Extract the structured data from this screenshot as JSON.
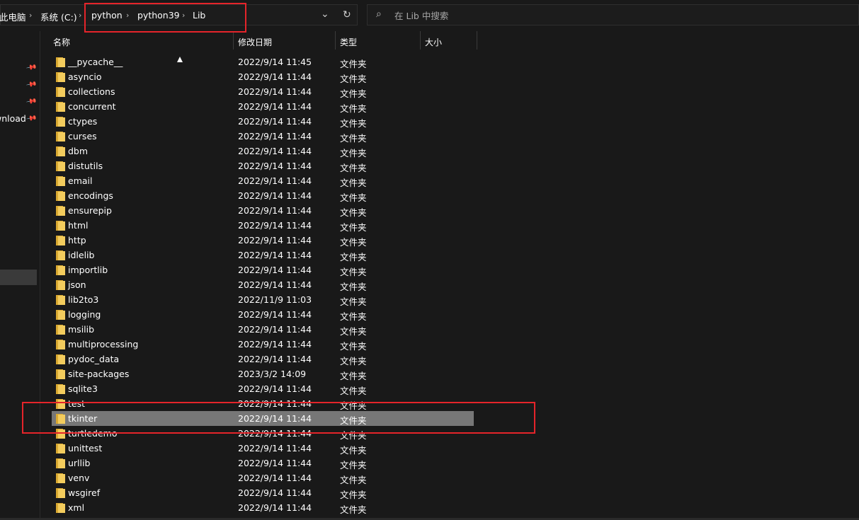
{
  "breadcrumb": {
    "items": [
      "此电脑",
      "系统 (C:)",
      "python",
      "python39",
      "Lib"
    ],
    "separator_icon": "chevron-right-icon"
  },
  "address_tools": {
    "dropdown_icon": "chevron-down-icon",
    "refresh_icon": "refresh-icon"
  },
  "search": {
    "placeholder": "在 Lib 中搜索",
    "value": "",
    "icon": "search-icon"
  },
  "navigation": {
    "partial_label": "wnload",
    "pin_icon": "pin-icon"
  },
  "columns": {
    "name": "名称",
    "date": "修改日期",
    "type": "类型",
    "size": "大小"
  },
  "files": [
    {
      "name": "__pycache__",
      "date": "2022/9/14 11:45",
      "type": "文件夹"
    },
    {
      "name": "asyncio",
      "date": "2022/9/14 11:44",
      "type": "文件夹"
    },
    {
      "name": "collections",
      "date": "2022/9/14 11:44",
      "type": "文件夹"
    },
    {
      "name": "concurrent",
      "date": "2022/9/14 11:44",
      "type": "文件夹"
    },
    {
      "name": "ctypes",
      "date": "2022/9/14 11:44",
      "type": "文件夹"
    },
    {
      "name": "curses",
      "date": "2022/9/14 11:44",
      "type": "文件夹"
    },
    {
      "name": "dbm",
      "date": "2022/9/14 11:44",
      "type": "文件夹"
    },
    {
      "name": "distutils",
      "date": "2022/9/14 11:44",
      "type": "文件夹"
    },
    {
      "name": "email",
      "date": "2022/9/14 11:44",
      "type": "文件夹"
    },
    {
      "name": "encodings",
      "date": "2022/9/14 11:44",
      "type": "文件夹"
    },
    {
      "name": "ensurepip",
      "date": "2022/9/14 11:44",
      "type": "文件夹"
    },
    {
      "name": "html",
      "date": "2022/9/14 11:44",
      "type": "文件夹"
    },
    {
      "name": "http",
      "date": "2022/9/14 11:44",
      "type": "文件夹"
    },
    {
      "name": "idlelib",
      "date": "2022/9/14 11:44",
      "type": "文件夹"
    },
    {
      "name": "importlib",
      "date": "2022/9/14 11:44",
      "type": "文件夹"
    },
    {
      "name": "json",
      "date": "2022/9/14 11:44",
      "type": "文件夹"
    },
    {
      "name": "lib2to3",
      "date": "2022/11/9 11:03",
      "type": "文件夹"
    },
    {
      "name": "logging",
      "date": "2022/9/14 11:44",
      "type": "文件夹"
    },
    {
      "name": "msilib",
      "date": "2022/9/14 11:44",
      "type": "文件夹"
    },
    {
      "name": "multiprocessing",
      "date": "2022/9/14 11:44",
      "type": "文件夹"
    },
    {
      "name": "pydoc_data",
      "date": "2022/9/14 11:44",
      "type": "文件夹"
    },
    {
      "name": "site-packages",
      "date": "2023/3/2 14:09",
      "type": "文件夹"
    },
    {
      "name": "sqlite3",
      "date": "2022/9/14 11:44",
      "type": "文件夹"
    },
    {
      "name": "test",
      "date": "2022/9/14 11:44",
      "type": "文件夹"
    },
    {
      "name": "tkinter",
      "date": "2022/9/14 11:44",
      "type": "文件夹",
      "selected": true
    },
    {
      "name": "turtledemo",
      "date": "2022/9/14 11:44",
      "type": "文件夹"
    },
    {
      "name": "unittest",
      "date": "2022/9/14 11:44",
      "type": "文件夹"
    },
    {
      "name": "urllib",
      "date": "2022/9/14 11:44",
      "type": "文件夹"
    },
    {
      "name": "venv",
      "date": "2022/9/14 11:44",
      "type": "文件夹"
    },
    {
      "name": "wsgiref",
      "date": "2022/9/14 11:44",
      "type": "文件夹"
    },
    {
      "name": "xml",
      "date": "2022/9/14 11:44",
      "type": "文件夹"
    }
  ],
  "colors": {
    "background": "#191919",
    "selection": "#777777",
    "folder": "#f3cc5d",
    "highlight_box": "#e5242a"
  }
}
